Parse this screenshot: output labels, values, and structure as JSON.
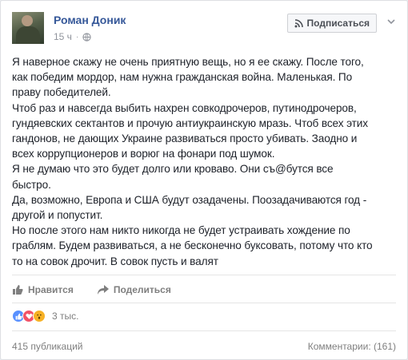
{
  "post": {
    "author": "Роман Доник",
    "time": "15 ч",
    "subscribe_label": "Подписаться",
    "lines": [
      "Я наверное скажу не очень приятную вещь, но я ее скажу. После того,",
      "как победим мордор, нам нужна гражданская война. Маленькая. По",
      "праву победителей.",
      "Чтоб раз и навсегда выбить нахрен совкодрочеров, путинодрочеров,",
      "гундяевских сектантов и прочую антиукраинскую мразь. Чтоб всех этих",
      "гандонов, не дающих Украине развиваться просто убивать. Заодно и",
      "всех коррупционеров и ворюг на фонари под шумок.",
      "Я не думаю что это будет долго или кроваво. Они съ@бутся все",
      "быстро.",
      "Да, возможно, Европа и США будут озадачены. Поозадачиваются год -",
      "другой и попустит.",
      "Но после этого нам никто никогда не будет устраивать хождение по",
      "граблям. Будем развиваться, а не бесконечно буксовать, потому что кто",
      "то на совок дрочит. В совок пусть и валят"
    ]
  },
  "actions": {
    "like_label": "Нравится",
    "share_label": "Поделиться"
  },
  "reactions": {
    "count": "3 тыс."
  },
  "stats": {
    "shares": "415 публикаций",
    "comments": "Комментарии: (161)"
  },
  "colors": {
    "link": "#365899",
    "muted": "#90949c",
    "like_blue": "#5890ff",
    "love_red": "#f25268",
    "wow_yellow": "#f7b125"
  }
}
